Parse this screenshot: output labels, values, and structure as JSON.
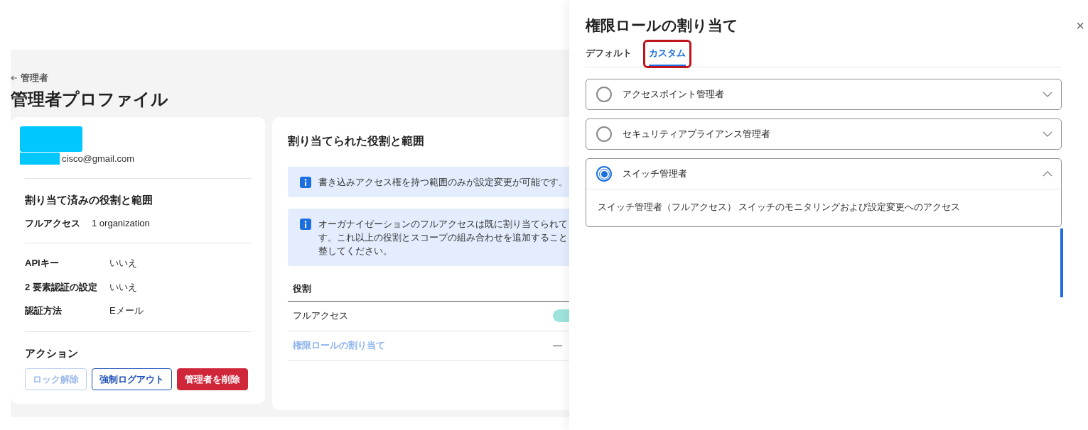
{
  "breadcrumb": {
    "label": "管理者"
  },
  "page_title": "管理者プロファイル",
  "profile_card": {
    "email": "cisco@gmail.com",
    "roles_heading": "割り当て済みの役割と範囲",
    "role": {
      "label": "フルアクセス",
      "value": "1 organization"
    },
    "details": [
      {
        "label": "APIキー",
        "value": "いいえ"
      },
      {
        "label": "2 要素認証の設定",
        "value": "いいえ"
      },
      {
        "label": "認証方法",
        "value": "Eメール"
      }
    ],
    "actions_heading": "アクション",
    "buttons": [
      {
        "label": "ロック解除",
        "kind": "outline",
        "disabled": true
      },
      {
        "label": "強制ログアウト",
        "kind": "outline",
        "disabled": false
      },
      {
        "label": "管理者を削除",
        "kind": "danger",
        "disabled": false
      }
    ]
  },
  "roles_card": {
    "title": "割り当てられた役割と範囲",
    "notices": [
      {
        "lines": [
          "書き込みアクセス権を持つ範囲のみが設定変更が可能です。"
        ]
      },
      {
        "lines": [
          "オーガナイゼーションのフルアクセスは既に割り当てられて",
          "す。これ以上の役割とスコープの組み合わせを追加すること",
          "整してください。"
        ]
      }
    ],
    "table": {
      "columns": [
        "役割"
      ],
      "rows": [
        {
          "kind": "text",
          "role": "フルアクセス",
          "scope": {
            "kind": "badge"
          }
        },
        {
          "kind": "link",
          "role": "権限ロールの割り当て",
          "scope": {
            "kind": "text",
            "text": "—"
          }
        }
      ]
    }
  },
  "drawer": {
    "title": "権限ロールの割り当て",
    "close": "×",
    "tabs": [
      {
        "label": "デフォルト",
        "selected": false,
        "highlighted": false
      },
      {
        "label": "カスタム",
        "selected": true,
        "highlighted": true
      }
    ],
    "options": [
      {
        "label": "アクセスポイント管理者",
        "selected": false,
        "expanded": false
      },
      {
        "label": "セキュリティアプライアンス管理者",
        "selected": false,
        "expanded": false
      },
      {
        "label": "スイッチ管理者",
        "selected": true,
        "expanded": true,
        "description": "スイッチ管理者（フルアクセス） スイッチのモニタリングおよび設定変更へのアクセス"
      }
    ]
  }
}
